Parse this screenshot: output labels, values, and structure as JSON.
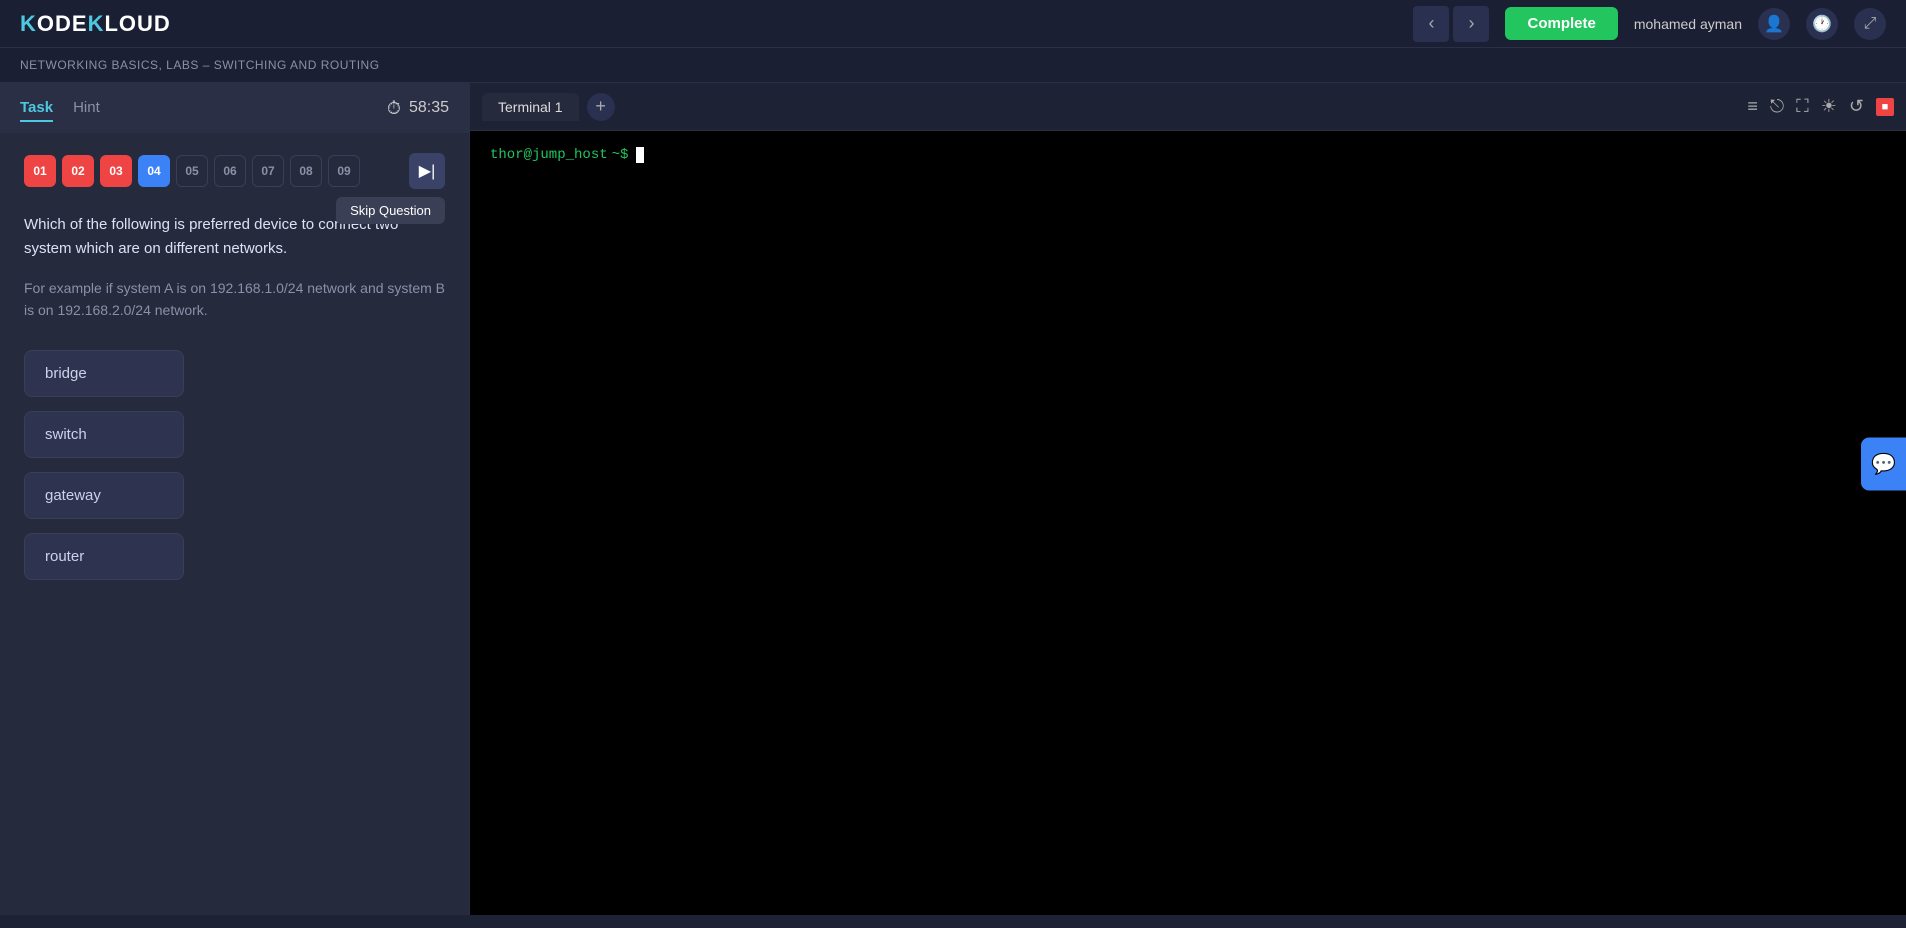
{
  "header": {
    "logo_text": "KODEKLOUD",
    "logo_k": "K",
    "user_name": "mohamed ayman",
    "complete_label": "Complete",
    "nav_prev": "‹",
    "nav_next": "›"
  },
  "breadcrumb": {
    "text": "NETWORKING BASICS, LABS – SWITCHING AND ROUTING"
  },
  "left_panel": {
    "tab_task": "Task",
    "tab_hint": "Hint",
    "timer_label": "58:35",
    "steps": [
      {
        "label": "01",
        "state": "completed"
      },
      {
        "label": "02",
        "state": "completed"
      },
      {
        "label": "03",
        "state": "completed"
      },
      {
        "label": "04",
        "state": "active"
      },
      {
        "label": "05",
        "state": "inactive"
      },
      {
        "label": "06",
        "state": "inactive"
      },
      {
        "label": "07",
        "state": "inactive"
      },
      {
        "label": "08",
        "state": "inactive"
      },
      {
        "label": "09",
        "state": "inactive"
      }
    ],
    "skip_tooltip": "Skip Question",
    "question_main": "Which of the following is preferred device to connect two system which are on different networks.",
    "question_example": "For example if system A is on 192.168.1.0/24 network and system B is on 192.168.2.0/24 network.",
    "answers": [
      {
        "label": "bridge"
      },
      {
        "label": "switch"
      },
      {
        "label": "gateway"
      },
      {
        "label": "router"
      }
    ]
  },
  "terminal": {
    "tab_label": "Terminal 1",
    "add_icon": "+",
    "prompt_host": "thor@jump_host",
    "prompt_path": " ~$",
    "icons": {
      "menu": "≡",
      "popout": "⎋",
      "fullscreen": "⛶",
      "brightness": "☀",
      "refresh": "↺",
      "close_color": "#ef4444"
    }
  },
  "chat": {
    "icon": "💬"
  }
}
